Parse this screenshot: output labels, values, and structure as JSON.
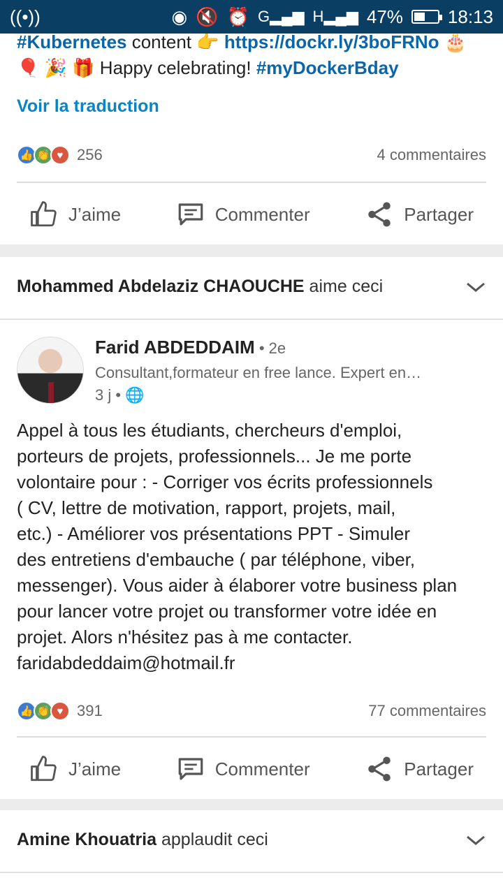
{
  "status": {
    "mini1": "G",
    "mini2": "H",
    "battery": "47%",
    "time": "18:13"
  },
  "post1": {
    "line1_hashtag": "#Kubernetes",
    "line1_text": " content ",
    "line1_emoji": "👉",
    "line1_link": "https://dockr.ly/3boFRNo",
    "line1_emoji2": "🎂",
    "line2_emojis": "🎈 🎉 🎁",
    "line2_text": "  Happy celebrating! ",
    "line2_hashtag": "#myDockerBday",
    "see_translation": "Voir la traduction",
    "reaction_count": "256",
    "comments": "4 commentaires"
  },
  "actions": {
    "like": "J’aime",
    "comment": "Commenter",
    "share": "Partager"
  },
  "post2": {
    "activity_actor": "Mohammed Abdelaziz CHAOUCHE",
    "activity_verb": " aime ceci",
    "author_name": "Farid ABDEDDAIM",
    "author_degree": " • 2e",
    "author_headline": "Consultant,formateur en free lance. Expert en…",
    "post_age": "3 j •",
    "body_lines": [
      "Appel à tous les étudiants, chercheurs d'emploi,",
      "porteurs de projets, professionnels... Je me porte",
      "volontaire pour : - Corriger vos écrits professionnels",
      "( CV, lettre de motivation, rapport, projets, mail,",
      "etc.) - Améliorer vos présentations PPT - Simuler",
      "des entretiens d'embauche ( par téléphone, viber,",
      "messenger). Vous aider à élaborer votre business plan",
      "pour lancer votre projet ou transformer votre idée en",
      "projet. Alors n'hésitez pas à me contacter.",
      "faridabdeddaim@hotmail.fr"
    ],
    "reaction_count": "391",
    "comments": "77 commentaires"
  },
  "post3": {
    "activity_actor": "Amine Khouatria",
    "activity_verb": " applaudit ceci"
  },
  "battery_level": 0.47
}
